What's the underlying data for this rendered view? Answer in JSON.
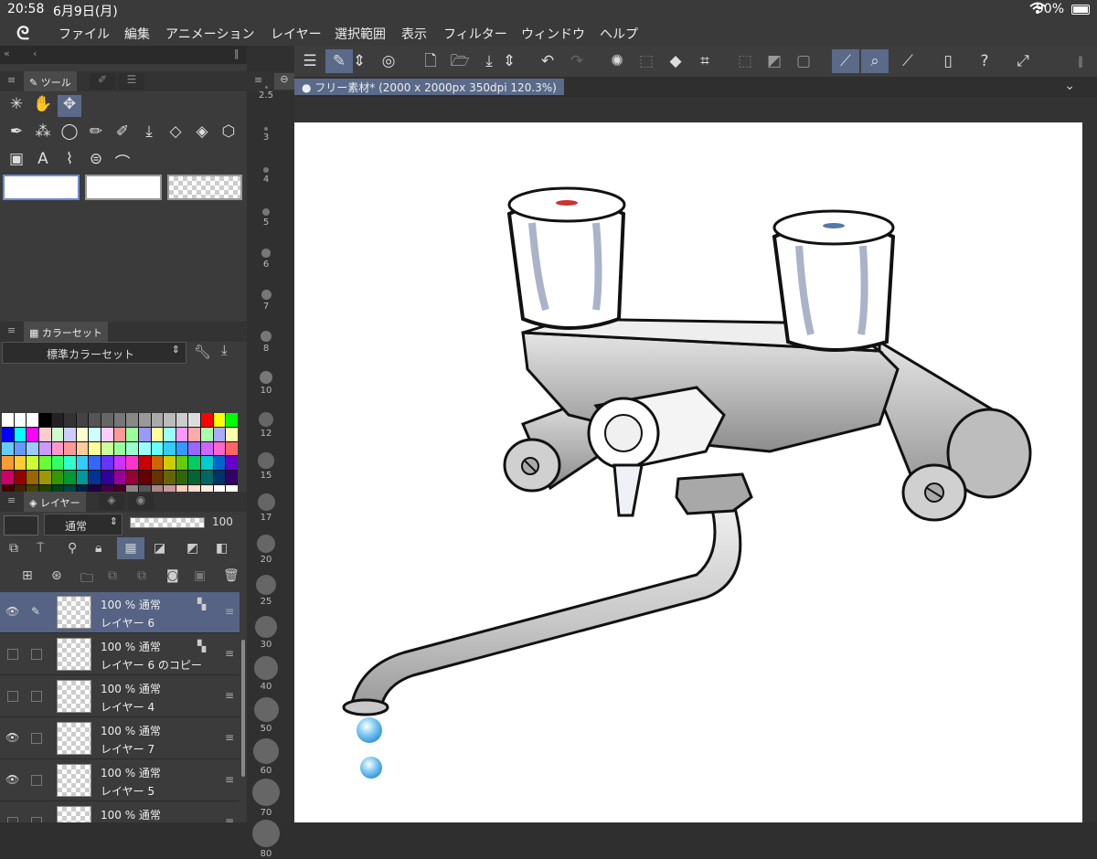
{
  "status": {
    "time": "20:58",
    "date": "6月9日(月)",
    "battery": "90%"
  },
  "menu": {
    "items": [
      "ファイル",
      "編集",
      "アニメーション",
      "レイヤー",
      "選択範囲",
      "表示",
      "フィルター",
      "ウィンドウ",
      "ヘルプ"
    ]
  },
  "tool_panel": {
    "tab_label": "ツール"
  },
  "colorset_panel": {
    "tab_label": "カラーセット",
    "selected": "標準カラーセット"
  },
  "layer_panel": {
    "tab_label": "レイヤー",
    "blend_mode": "通常",
    "opacity": "100",
    "layers": [
      {
        "opacity_mode": "100 % 通常",
        "name": "レイヤー 6",
        "visible": true,
        "selected": true
      },
      {
        "opacity_mode": "100 % 通常",
        "name": "レイヤー 6 のコピー",
        "visible": false,
        "selected": false
      },
      {
        "opacity_mode": "100 % 通常",
        "name": "レイヤー 4",
        "visible": false,
        "selected": false
      },
      {
        "opacity_mode": "100 % 通常",
        "name": "レイヤー 7",
        "visible": true,
        "selected": false
      },
      {
        "opacity_mode": "100 % 通常",
        "name": "レイヤー 5",
        "visible": true,
        "selected": false
      },
      {
        "opacity_mode": "100 % 通常",
        "name": "",
        "visible": false,
        "selected": false
      }
    ]
  },
  "brush_sizes": [
    "2.5",
    "3",
    "4",
    "5",
    "6",
    "7",
    "8",
    "10",
    "12",
    "15",
    "17",
    "20",
    "25",
    "30",
    "40",
    "50",
    "60",
    "70",
    "80"
  ],
  "document": {
    "tab_title": "フリー素材* (2000 x 2000px 350dpi 120.3%)"
  },
  "colors": {
    "accent": "#5a6a88",
    "panel": "#3b3b3b",
    "canvas_bg": "#ffffff"
  }
}
